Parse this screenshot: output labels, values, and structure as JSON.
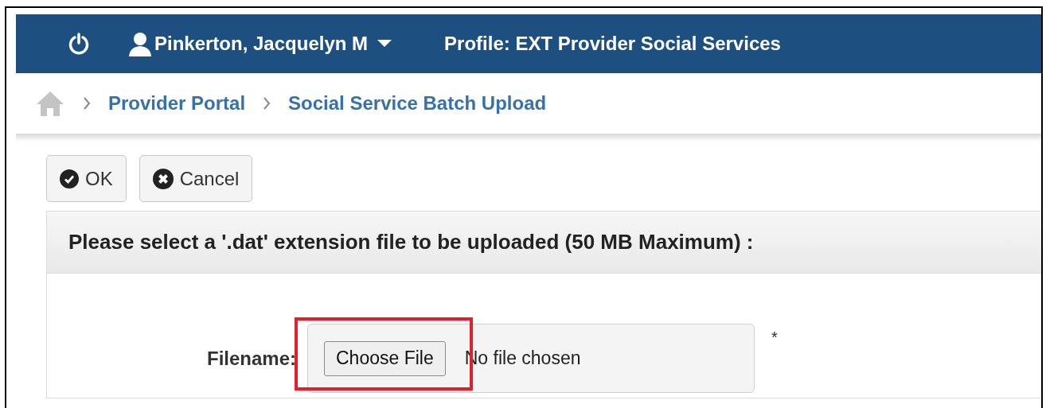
{
  "top_bar": {
    "user_name": "Pinkerton, Jacquelyn M",
    "profile": "Profile: EXT Provider Social Services"
  },
  "breadcrumb": [
    "Provider Portal",
    "Social Service Batch Upload"
  ],
  "buttons": [
    {
      "kind": "ok",
      "label": "OK"
    },
    {
      "kind": "cancel",
      "label": "Cancel"
    }
  ],
  "panel": {
    "title": "Please select a '.dat' extension file to be uploaded (50 MB Maximum) :",
    "field": {
      "label": "Filename:",
      "button": "Choose File",
      "status": "No file chosen",
      "required_mark": "*",
      "highlighted": true
    }
  }
}
